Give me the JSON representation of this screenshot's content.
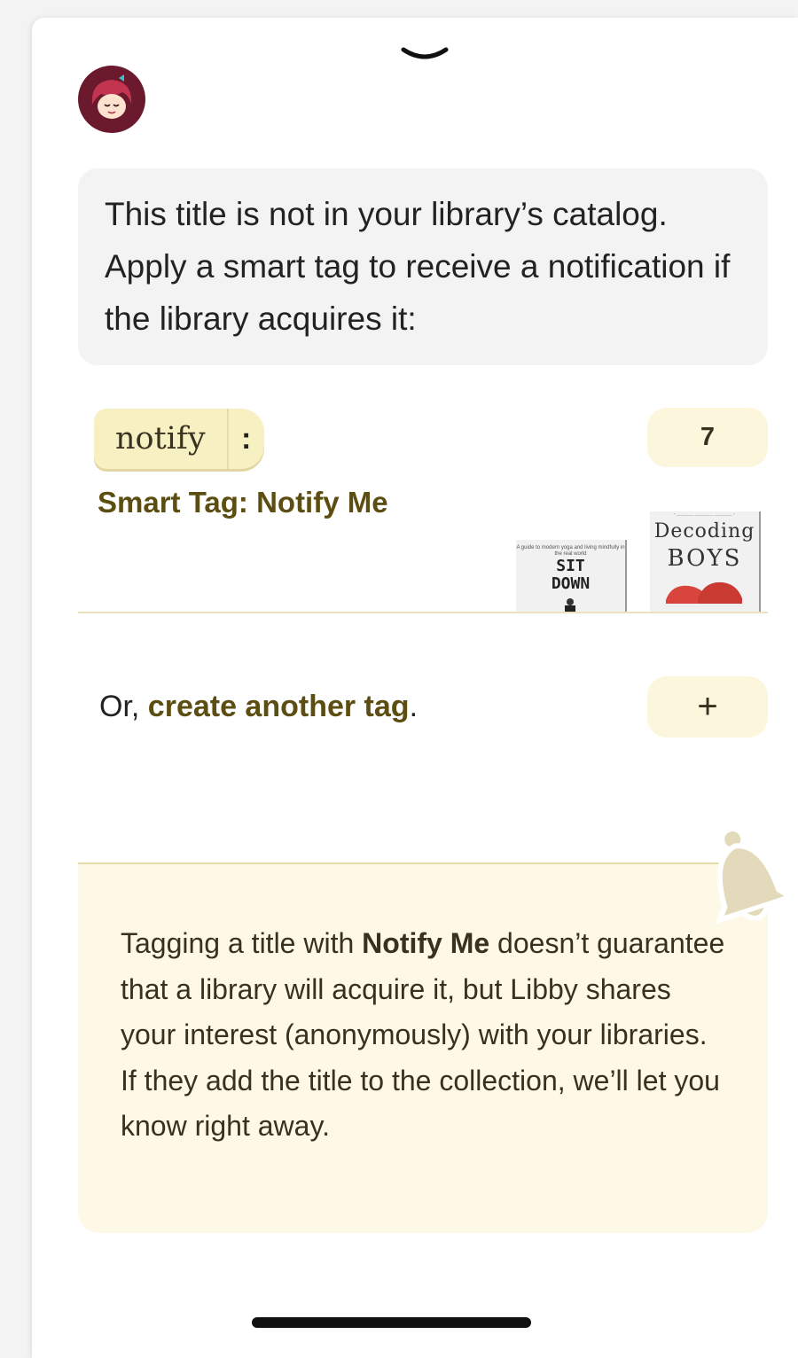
{
  "info": {
    "message": "This title is not in your library’s catalog. Apply a smart tag to receive a notification if the library acquires it:"
  },
  "tag": {
    "name": "notify",
    "menu_glyph": ":",
    "count": "7",
    "title": "Smart Tag: Notify Me"
  },
  "books": [
    {
      "tagline": "A guide to modern yoga and living mindfully in the real world",
      "title_line1": "SIT",
      "title_line2": "DOWN"
    },
    {
      "title_line1": "Decoding",
      "title_line2": "BOYS"
    }
  ],
  "create": {
    "prefix": "Or, ",
    "link_label": "create another tag",
    "suffix": ".",
    "plus_label": "+"
  },
  "note": {
    "part1": "Tagging a title with ",
    "bold": "Notify Me",
    "part2": " doesn’t guarantee that a library will acquire it, but Libby shares your interest (anonymously) with your libraries. If they add the title to the collection, we’ll let you know right away."
  },
  "colors": {
    "accent": "#5c4e12",
    "pill_bg": "#fbf6dc",
    "note_bg": "#fdf9e6",
    "avatar": "#6b1a2e"
  },
  "icons": [
    "chevron-down-icon",
    "libby-avatar-icon",
    "bell-icon"
  ]
}
